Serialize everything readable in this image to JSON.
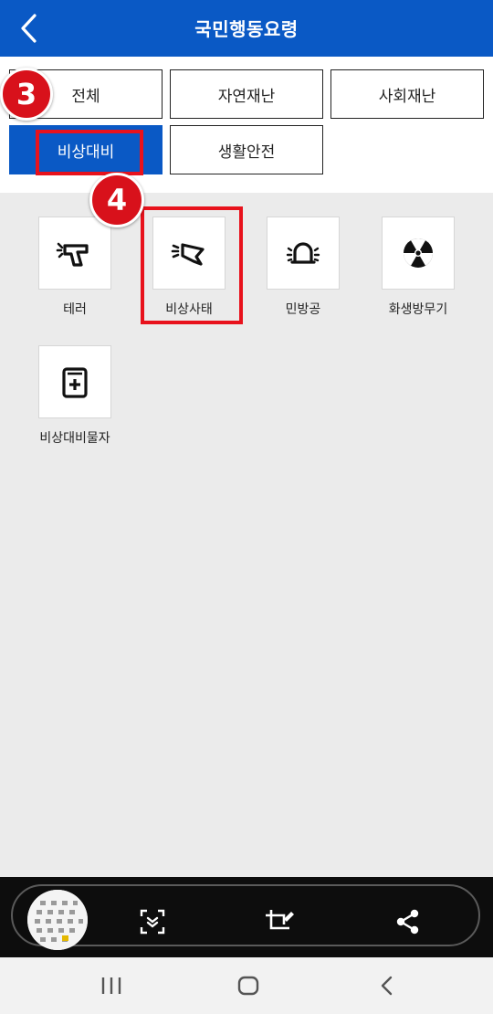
{
  "header": {
    "title": "국민행동요령"
  },
  "tabs": [
    {
      "label": "전체",
      "active": false
    },
    {
      "label": "자연재난",
      "active": false
    },
    {
      "label": "사회재난",
      "active": false
    },
    {
      "label": "비상대비",
      "active": true
    },
    {
      "label": "생활안전",
      "active": false
    }
  ],
  "markers": {
    "step3": "3",
    "step4": "4"
  },
  "items": [
    {
      "label": "테러",
      "icon": "gun-icon"
    },
    {
      "label": "비상사태",
      "icon": "megaphone-icon"
    },
    {
      "label": "민방공",
      "icon": "siren-icon"
    },
    {
      "label": "화생방무기",
      "icon": "radiation-icon"
    },
    {
      "label": "비상대비물자",
      "icon": "first-aid-kit-icon"
    }
  ],
  "toolbar": {
    "icons": [
      "scroll-capture-icon",
      "crop-edit-icon",
      "share-icon"
    ]
  },
  "navbar": {
    "icons": [
      "recent-apps-icon",
      "home-icon",
      "back-icon"
    ]
  },
  "colors": {
    "primary": "#0a59c5",
    "marker": "#d8111b",
    "highlight": "#e8121c"
  }
}
